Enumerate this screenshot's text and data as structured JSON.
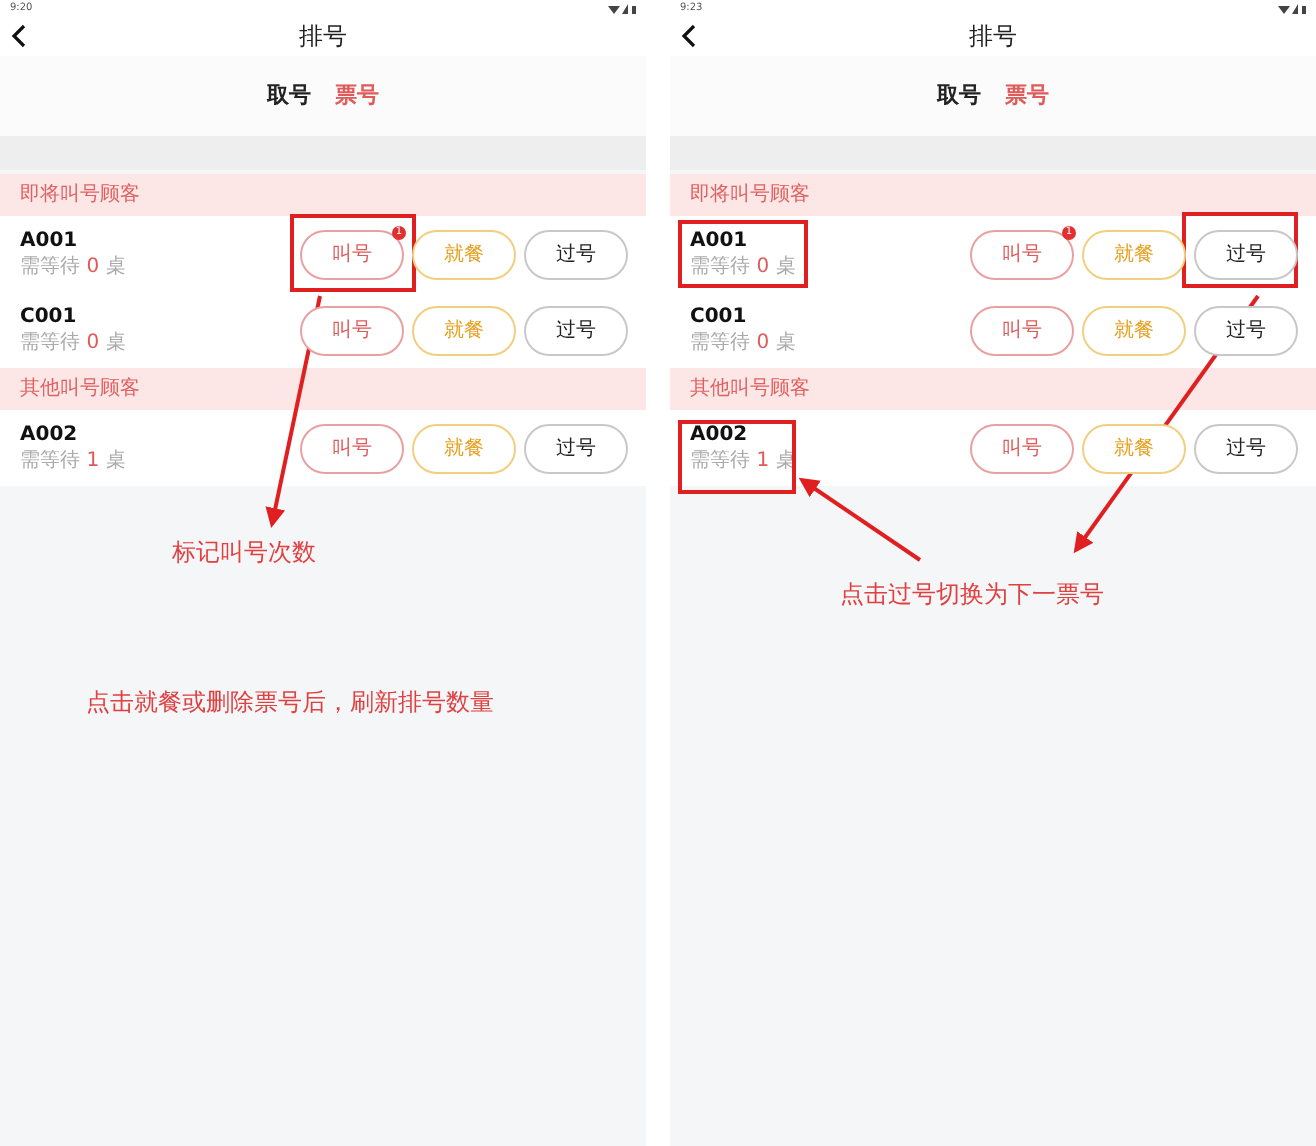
{
  "screens": [
    {
      "time": "9:20",
      "title": "排号",
      "tabs": [
        {
          "label": "取号",
          "selected": false
        },
        {
          "label": "票号",
          "selected": true
        }
      ],
      "sections": [
        {
          "title": "即将叫号顾客",
          "tickets": [
            {
              "number": "A001",
              "wait_prefix": "需等待",
              "wait_count": "0",
              "wait_suffix": "桌",
              "actions": [
                {
                  "label": "叫号",
                  "kind": "call",
                  "badge": "1"
                },
                {
                  "label": "就餐",
                  "kind": "dine"
                },
                {
                  "label": "过号",
                  "kind": "skip"
                }
              ]
            },
            {
              "number": "C001",
              "wait_prefix": "需等待",
              "wait_count": "0",
              "wait_suffix": "桌",
              "actions": [
                {
                  "label": "叫号",
                  "kind": "call"
                },
                {
                  "label": "就餐",
                  "kind": "dine"
                },
                {
                  "label": "过号",
                  "kind": "skip"
                }
              ]
            }
          ]
        },
        {
          "title": "其他叫号顾客",
          "tickets": [
            {
              "number": "A002",
              "wait_prefix": "需等待",
              "wait_count": "1",
              "wait_suffix": "桌",
              "actions": [
                {
                  "label": "叫号",
                  "kind": "call"
                },
                {
                  "label": "就餐",
                  "kind": "dine"
                },
                {
                  "label": "过号",
                  "kind": "skip"
                }
              ]
            }
          ]
        }
      ],
      "notes": [
        "标记叫号次数",
        "点击就餐或删除票号后，刷新排号数量"
      ]
    },
    {
      "time": "9:23",
      "title": "排号",
      "tabs": [
        {
          "label": "取号",
          "selected": false
        },
        {
          "label": "票号",
          "selected": true
        }
      ],
      "sections": [
        {
          "title": "即将叫号顾客",
          "tickets": [
            {
              "number": "A001",
              "wait_prefix": "需等待",
              "wait_count": "0",
              "wait_suffix": "桌",
              "actions": [
                {
                  "label": "叫号",
                  "kind": "call",
                  "badge": "1"
                },
                {
                  "label": "就餐",
                  "kind": "dine"
                },
                {
                  "label": "过号",
                  "kind": "skip"
                }
              ]
            },
            {
              "number": "C001",
              "wait_prefix": "需等待",
              "wait_count": "0",
              "wait_suffix": "桌",
              "actions": [
                {
                  "label": "叫号",
                  "kind": "call"
                },
                {
                  "label": "就餐",
                  "kind": "dine"
                },
                {
                  "label": "过号",
                  "kind": "skip"
                }
              ]
            }
          ]
        },
        {
          "title": "其他叫号顾客",
          "tickets": [
            {
              "number": "A002",
              "wait_prefix": "需等待",
              "wait_count": "1",
              "wait_suffix": "桌",
              "actions": [
                {
                  "label": "叫号",
                  "kind": "call"
                },
                {
                  "label": "就餐",
                  "kind": "dine"
                },
                {
                  "label": "过号",
                  "kind": "skip"
                }
              ]
            }
          ]
        }
      ],
      "notes": [
        "点击过号切换为下一票号"
      ]
    }
  ]
}
